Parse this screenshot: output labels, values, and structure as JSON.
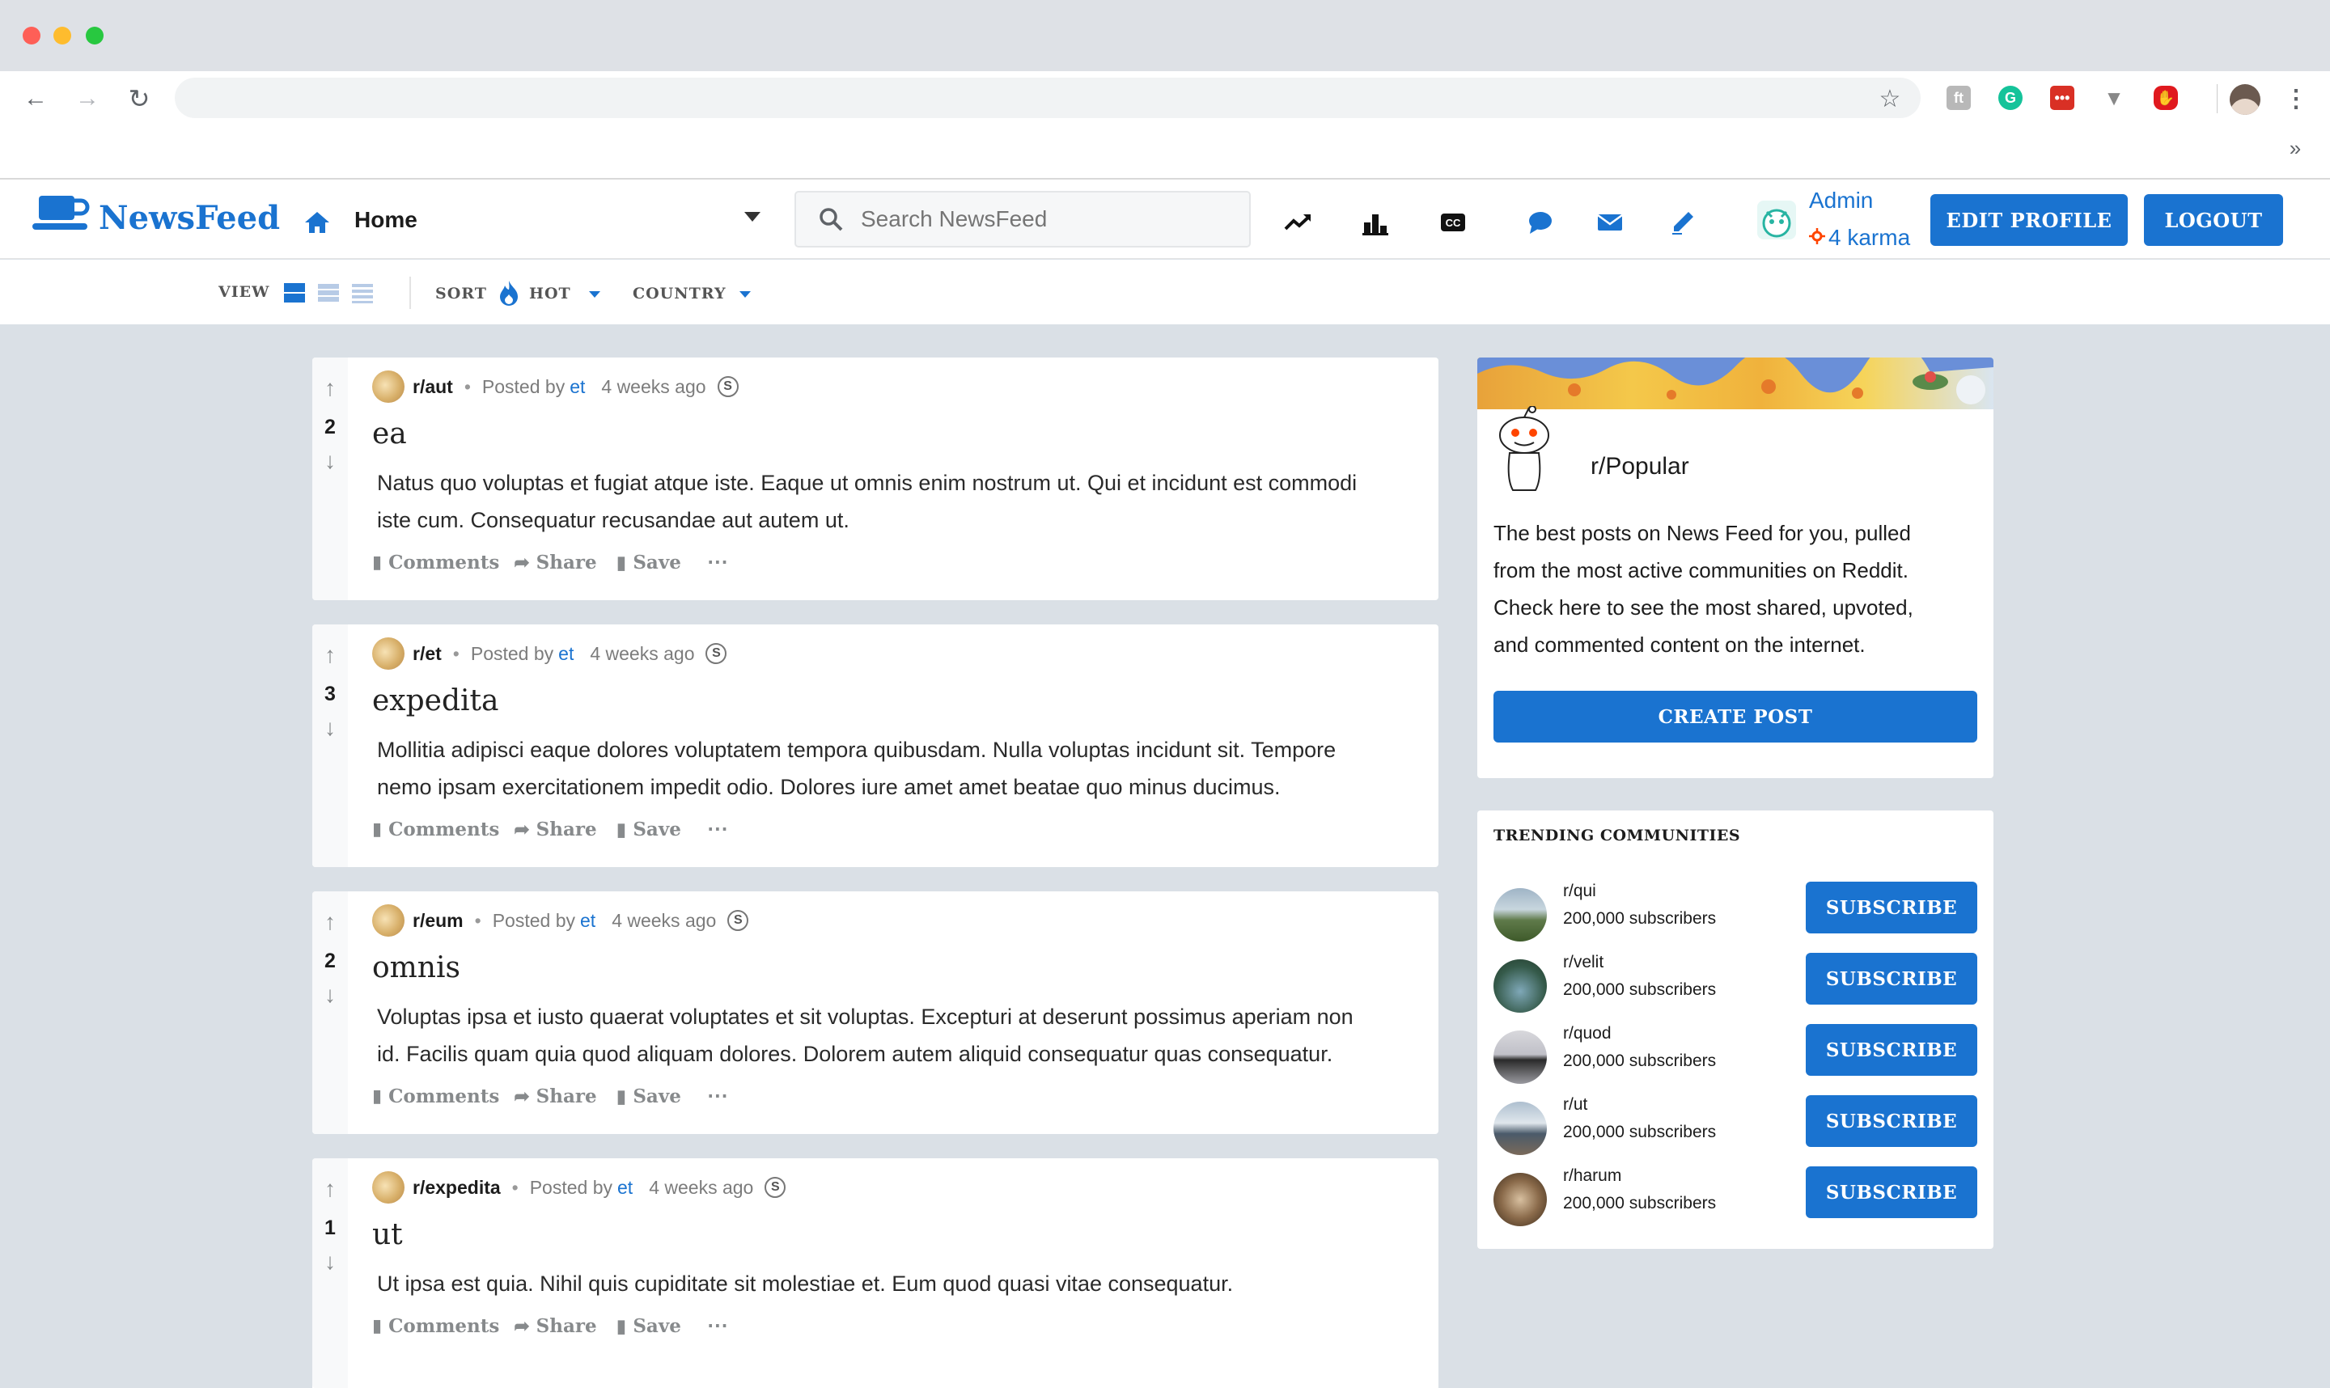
{
  "browser": {
    "url": "",
    "extensions": [
      "font-icon",
      "grammarly-icon",
      "dots-icon",
      "vivaldi-icon",
      "adblock-icon"
    ]
  },
  "header": {
    "brand": "NewsFeed",
    "nav_home": "Home",
    "search_placeholder": "Search NewsFeed",
    "user_name": "Admin",
    "user_karma": "4 karma",
    "edit_profile": "EDIT PROFILE",
    "logout": "LOGOUT",
    "accent_color": "#1a73d0"
  },
  "toolbar": {
    "view_label": "VIEW",
    "sort_label": "SORT",
    "sort_value": "HOT",
    "country_label": "COUNTRY"
  },
  "posts": [
    {
      "subreddit": "r/aut",
      "posted_by": "Posted by",
      "author": "et",
      "time": "4 weeks ago",
      "score": "2",
      "title": "ea",
      "body_line1": "Natus quo voluptas et fugiat atque iste. Eaque ut omnis enim nostrum ut. Qui et incidunt est commodi",
      "body_line2": "iste cum. Consequatur recusandae aut autem ut.",
      "comments": "Comments",
      "share": "Share",
      "save": "Save"
    },
    {
      "subreddit": "r/et",
      "posted_by": "Posted by",
      "author": "et",
      "time": "4 weeks ago",
      "score": "3",
      "title": "expedita",
      "body_line1": "Mollitia adipisci eaque dolores voluptatem tempora quibusdam. Nulla voluptas incidunt sit. Tempore",
      "body_line2": "nemo ipsam exercitationem impedit odio. Dolores iure amet amet beatae quo minus ducimus.",
      "comments": "Comments",
      "share": "Share",
      "save": "Save"
    },
    {
      "subreddit": "r/eum",
      "posted_by": "Posted by",
      "author": "et",
      "time": "4 weeks ago",
      "score": "2",
      "title": "omnis",
      "body_line1": "Voluptas ipsa et iusto quaerat voluptates et sit voluptas. Excepturi at deserunt possimus aperiam non",
      "body_line2": "id. Facilis quam quia quod aliquam dolores. Dolorem autem aliquid consequatur quas consequatur.",
      "comments": "Comments",
      "share": "Share",
      "save": "Save"
    },
    {
      "subreddit": "r/expedita",
      "posted_by": "Posted by",
      "author": "et",
      "time": "4 weeks ago",
      "score": "1",
      "title": "ut",
      "body_line1": "Ut ipsa est quia. Nihil quis cupiditate sit molestiae et. Eum quod quasi vitae consequatur.",
      "body_line2": "",
      "comments": "Comments",
      "share": "Share",
      "save": "Save"
    }
  ],
  "sidebar": {
    "popular_title": "r/Popular",
    "popular_desc_1": "The best posts on News Feed for you, pulled",
    "popular_desc_2": "from the most active communities on Reddit.",
    "popular_desc_3": "Check here to see the most shared, upvoted,",
    "popular_desc_4": "and commented content on the internet.",
    "create_post": "CREATE POST",
    "trending_title": "TRENDING COMMUNITIES",
    "communities": [
      {
        "name": "r/qui",
        "subscribers": "200,000 subscribers",
        "button": "SUBSCRIBE"
      },
      {
        "name": "r/velit",
        "subscribers": "200,000 subscribers",
        "button": "SUBSCRIBE"
      },
      {
        "name": "r/quod",
        "subscribers": "200,000 subscribers",
        "button": "SUBSCRIBE"
      },
      {
        "name": "r/ut",
        "subscribers": "200,000 subscribers",
        "button": "SUBSCRIBE"
      },
      {
        "name": "r/harum",
        "subscribers": "200,000 subscribers",
        "button": "SUBSCRIBE"
      }
    ]
  }
}
